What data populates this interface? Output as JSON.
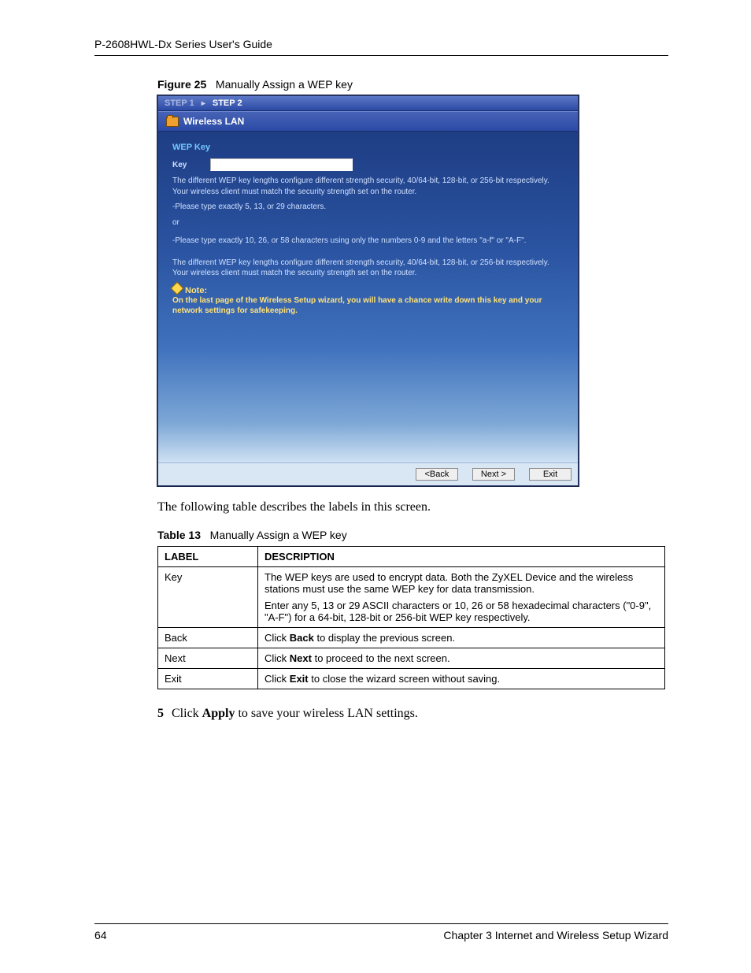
{
  "header": {
    "running_head": "P-2608HWL-Dx Series User's Guide"
  },
  "figure": {
    "prefix": "Figure 25",
    "title": "Manually Assign a WEP key"
  },
  "wizard": {
    "step1": "STEP 1",
    "step2": "STEP 2",
    "section_title": "Wireless LAN",
    "group_label": "WEP Key",
    "key_label": "Key",
    "key_value": "",
    "hint1": "The different WEP key lengths configure different strength security, 40/64-bit, 128-bit, or 256-bit respectively. Your wireless client must match the security strength set on the router.",
    "hint1b": "-Please type exactly 5, 13, or 29 characters.",
    "hint1c": "or",
    "hint2": "-Please type exactly 10, 26, or 58 characters using only the numbers 0-9 and the letters \"a-f\" or \"A-F\".",
    "hint3": "The different WEP key lengths configure different strength security, 40/64-bit, 128-bit, or 256-bit respectively. Your wireless client must match the security strength set on the router.",
    "note_head": "Note:",
    "note_body": "On the last page of the Wireless Setup wizard, you will have a chance write down this key and your network settings for safekeeping.",
    "btn_back": "<Back",
    "btn_next": "Next >",
    "btn_exit": "Exit"
  },
  "intro_text": "The following table describes the labels in this screen.",
  "table": {
    "prefix": "Table 13",
    "title": "Manually Assign a WEP key",
    "head_label": "LABEL",
    "head_desc": "DESCRIPTION",
    "rows": {
      "r0": {
        "label": "Key",
        "desc1": "The WEP keys are used to encrypt data. Both the ZyXEL Device and the wireless stations must use the same WEP key for data transmission.",
        "desc2": "Enter any 5, 13 or 29 ASCII characters or 10, 26 or 58 hexadecimal characters (\"0-9\", \"A-F\") for a 64-bit, 128-bit or 256-bit WEP key respectively."
      },
      "r1": {
        "label": "Back",
        "pre": "Click ",
        "bold": "Back",
        "post": " to display the previous screen."
      },
      "r2": {
        "label": "Next",
        "pre": "Click ",
        "bold": "Next",
        "post": " to proceed to the next screen."
      },
      "r3": {
        "label": "Exit",
        "pre": "Click ",
        "bold": "Exit",
        "post": " to close the wizard screen without saving."
      }
    }
  },
  "step": {
    "num": "5",
    "pre": " Click ",
    "bold": "Apply",
    "post": " to save your wireless LAN settings."
  },
  "footer": {
    "page": "64",
    "chapter": "Chapter 3 Internet and Wireless Setup Wizard"
  }
}
